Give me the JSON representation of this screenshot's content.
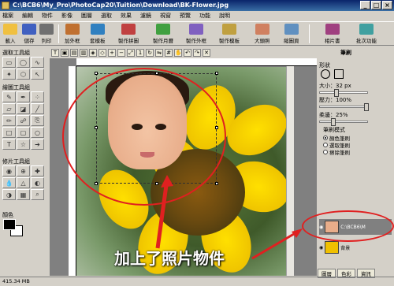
{
  "window": {
    "title": "C:\\BCB6\\My_Pro\\PhotoCap20\\Tuition\\Download\\BK-Flower.jpg"
  },
  "menu": [
    "檔案",
    "編輯",
    "物件",
    "影像",
    "圖層",
    "選取",
    "效果",
    "濾鏡",
    "視窗",
    "預覽",
    "功能",
    "說明"
  ],
  "toolbar": [
    {
      "label": "載入",
      "color": "#f0c040"
    },
    {
      "label": "儲存",
      "color": "#4060c0"
    },
    {
      "label": "列印",
      "color": "#707070"
    },
    {
      "label": "加外框",
      "color": "#c07030"
    },
    {
      "label": "套模板",
      "color": "#3080c0"
    },
    {
      "label": "製作拼圖",
      "color": "#c04040"
    },
    {
      "label": "製作月曆",
      "color": "#40a040"
    },
    {
      "label": "製作外框",
      "color": "#8060c0"
    },
    {
      "label": "製作模板",
      "color": "#c0a040"
    },
    {
      "label": "大頭照",
      "color": "#d08060"
    },
    {
      "label": "縮圖頁",
      "color": "#6090c0"
    },
    {
      "label": "相片書",
      "color": "#a04080"
    },
    {
      "label": "批次功能",
      "color": "#40a0a0"
    }
  ],
  "left_panel": {
    "select_group": "選取工具組",
    "draw_group": "繪圖工具組",
    "repair_group": "修片工具組",
    "color_label": "顏色"
  },
  "status": {
    "memory": "415.34 MB"
  },
  "right_panel": {
    "header": "筆刷",
    "shape_label": "形狀",
    "size_label": "大小：32 px",
    "pressure_label": "壓力：100%",
    "softness_label": "柔邊：25%",
    "brush_mode_label": "筆刷模式",
    "modes": [
      "顏色筆刷",
      "選取筆刷",
      "擦除筆刷"
    ],
    "size_value": 32,
    "pressure_value": 100,
    "softness_value": 25
  },
  "layers": [
    {
      "name": "C:\\BCB6\\M",
      "kind": "photo"
    },
    {
      "name": "背景",
      "kind": "background"
    }
  ],
  "layer_tabs": [
    "圖層",
    "色彩",
    "資訊"
  ],
  "annotation": {
    "text": "加上了照片物件"
  },
  "colors": {
    "annotation_red": "#e02020",
    "title_blue": "#0a246a"
  }
}
